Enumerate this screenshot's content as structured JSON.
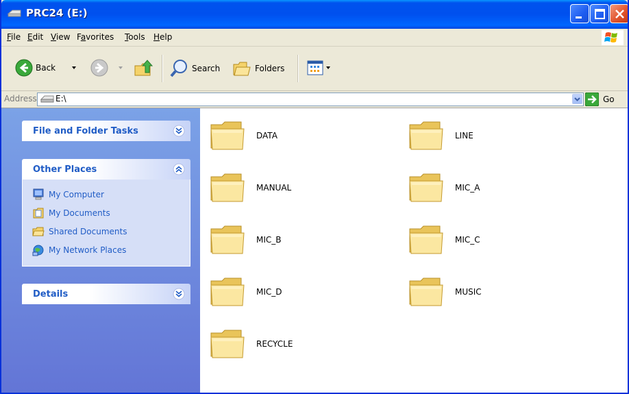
{
  "window": {
    "title": "PRC24 (E:)"
  },
  "menu": [
    "File",
    "Edit",
    "View",
    "Favorites",
    "Tools",
    "Help"
  ],
  "menu_underline": [
    "F",
    "E",
    "V",
    "a",
    "T",
    "H"
  ],
  "toolbar": {
    "back_label": "Back",
    "search_label": "Search",
    "folders_label": "Folders"
  },
  "address": {
    "label": "Address",
    "value": "E:\\",
    "go_label": "Go"
  },
  "taskpane": {
    "file_tasks_title": "File and Folder Tasks",
    "other_places_title": "Other Places",
    "other_places": [
      {
        "label": "My Computer",
        "icon": "my-computer-icon"
      },
      {
        "label": "My Documents",
        "icon": "my-documents-icon"
      },
      {
        "label": "Shared Documents",
        "icon": "shared-documents-icon"
      },
      {
        "label": "My Network Places",
        "icon": "network-places-icon"
      }
    ],
    "details_title": "Details"
  },
  "folders": [
    "DATA",
    "LINE",
    "MANUAL",
    "MIC_A",
    "MIC_B",
    "MIC_C",
    "MIC_D",
    "MUSIC",
    "RECYCLE"
  ],
  "colors": {
    "titlebar": "#0053ee",
    "taskpane_top": "#7ba2e7",
    "taskpane_bottom": "#6375d6",
    "link_blue": "#215dc6"
  }
}
